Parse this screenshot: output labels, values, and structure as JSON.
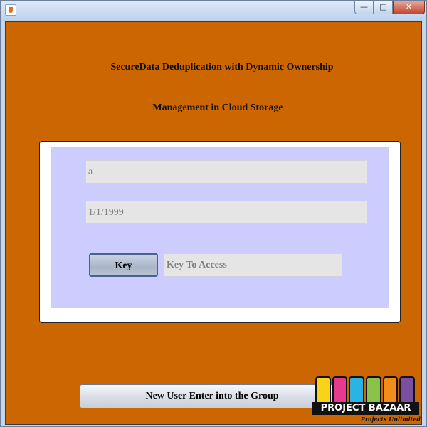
{
  "window": {
    "controls": {
      "minimize_glyph": "—",
      "maximize_glyph": "□",
      "close_glyph": "✕"
    }
  },
  "header": {
    "title_line1": "SecureData Deduplication with Dynamic Ownership",
    "title_line2": "Management in Cloud Storage"
  },
  "form": {
    "name_value": "a",
    "date_value": "1/1/1999",
    "key_button_label": "Key",
    "key_field_value": "Key To Access"
  },
  "footer": {
    "group_button_label": "New User Enter into the Group"
  },
  "logo": {
    "name": "PROJECT BAZAAR",
    "tagline": "Projects Unlimited",
    "colors": [
      "#f7d417",
      "#e83a8c",
      "#2ab4e6",
      "#8bc34a",
      "#f28c1c",
      "#7b4fa0"
    ]
  },
  "colors": {
    "frame_background": "#cc6600",
    "panel_background": "#ccccff",
    "field_background": "#e5e5e5"
  }
}
